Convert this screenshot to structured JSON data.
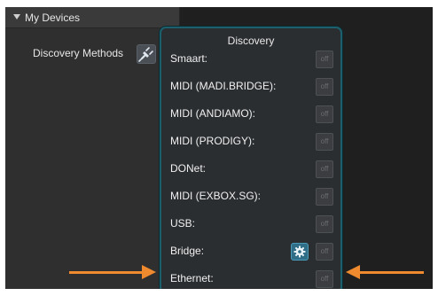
{
  "tree": {
    "title": "My Devices",
    "expand_icon": "triangle-down-icon"
  },
  "discovery_methods": {
    "label": "Discovery Methods",
    "button_icon": "plug-icon"
  },
  "popup": {
    "title": "Discovery",
    "toggle_text": "off",
    "rows": [
      {
        "label": "Smaart:"
      },
      {
        "label": "MIDI (MADI.BRIDGE):"
      },
      {
        "label": "MIDI (ANDIAMO):"
      },
      {
        "label": "MIDI (PRODIGY):"
      },
      {
        "label": "DONet:"
      },
      {
        "label": "MIDI (EXBOX.SG):"
      },
      {
        "label": "USB:"
      },
      {
        "label": "Bridge:",
        "has_settings": true
      },
      {
        "label": "Ethernet:"
      }
    ]
  },
  "colors": {
    "popup_border": "#1c5f6d",
    "annotation_arrow": "#ef8a2e",
    "gear_button": "#2f6e86"
  }
}
